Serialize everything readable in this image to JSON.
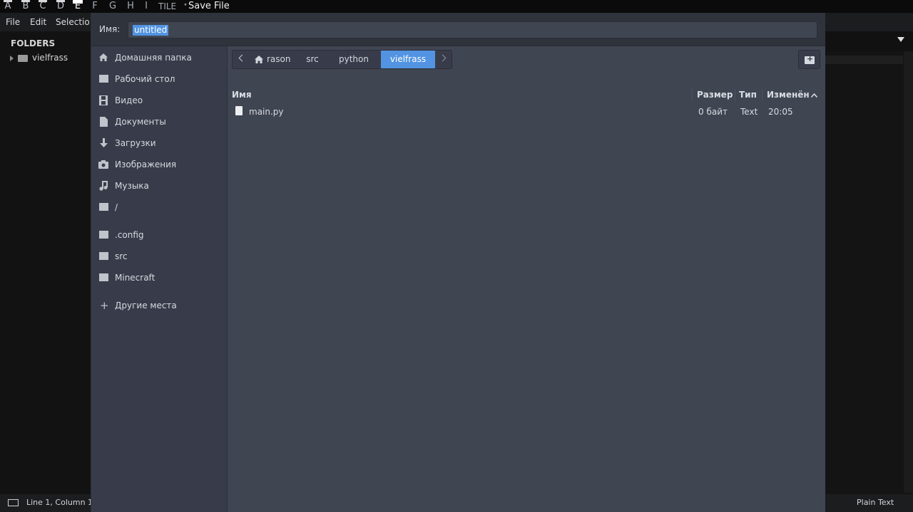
{
  "topbar": {
    "workspaces": [
      {
        "label": "A",
        "state": "used"
      },
      {
        "label": "B",
        "state": "used"
      },
      {
        "label": "C",
        "state": "used"
      },
      {
        "label": "D",
        "state": "used"
      },
      {
        "label": "E",
        "state": "active"
      },
      {
        "label": "F",
        "state": "inactive"
      },
      {
        "label": "G",
        "state": "inactive"
      },
      {
        "label": "H",
        "state": "inactive"
      },
      {
        "label": "I",
        "state": "inactive"
      }
    ],
    "layout_label": "TILE",
    "window_title": "Save File"
  },
  "editor": {
    "menu": [
      "File",
      "Edit",
      "Selectio"
    ],
    "sidebar_header": "FOLDERS",
    "sidebar_folder": "vielfrass",
    "status_position": "Line 1, Column 1",
    "status_syntax": "Plain Text"
  },
  "dialog": {
    "name_label": "Имя:",
    "name_value": "untitled",
    "places": [
      {
        "label": "Домашняя папка",
        "icon": "home-icon"
      },
      {
        "label": "Рабочий стол",
        "icon": "desktop-icon"
      },
      {
        "label": "Видео",
        "icon": "video-icon"
      },
      {
        "label": "Документы",
        "icon": "document-icon"
      },
      {
        "label": "Загрузки",
        "icon": "download-icon"
      },
      {
        "label": "Изображения",
        "icon": "camera-icon"
      },
      {
        "label": "Музыка",
        "icon": "music-icon"
      },
      {
        "label": "/",
        "icon": "folder-icon"
      },
      {
        "label": ".config",
        "icon": "folder-icon"
      },
      {
        "label": "src",
        "icon": "folder-icon"
      },
      {
        "label": "Minecraft",
        "icon": "folder-icon"
      },
      {
        "label": "Другие места",
        "icon": "plus-icon"
      }
    ],
    "path": [
      "rason",
      "src",
      "python",
      "vielfrass"
    ],
    "columns": {
      "name": "Имя",
      "size": "Размер",
      "type": "Тип",
      "modified": "Изменён"
    },
    "files": [
      {
        "name": "main.py",
        "size": "0 байт",
        "type": "Text",
        "modified": "20:05"
      }
    ],
    "accent": "#5294e2"
  }
}
